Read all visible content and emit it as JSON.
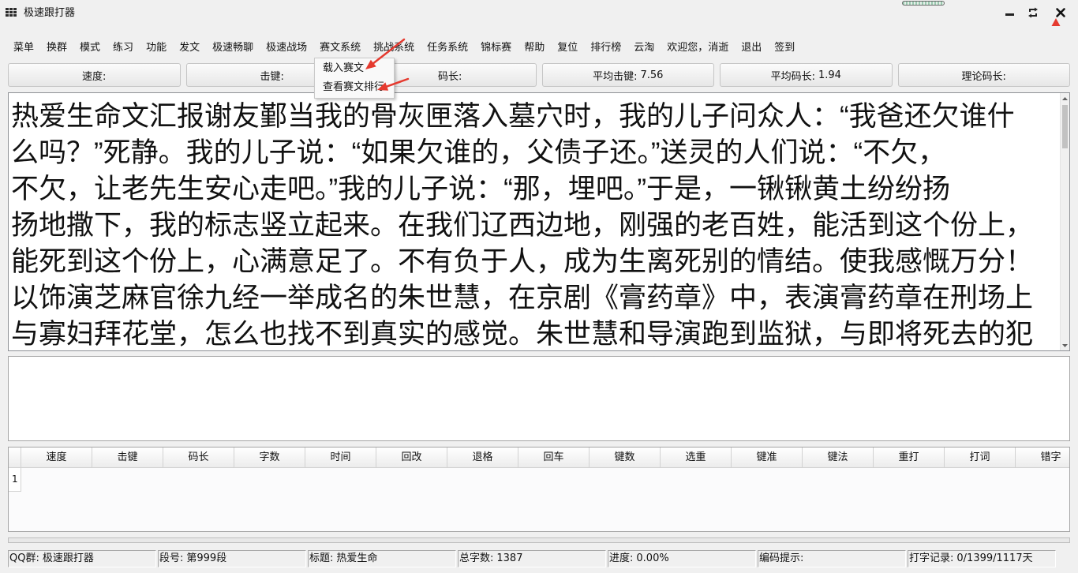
{
  "window": {
    "title": "极速跟打器",
    "icons": {
      "app": "grid-icon",
      "minimize": "minimize-icon",
      "restore": "restore-icon",
      "close": "close-icon"
    }
  },
  "menu": {
    "items": [
      "菜单",
      "换群",
      "模式",
      "练习",
      "功能",
      "发文",
      "极速畅聊",
      "极速战场",
      "赛文系统",
      "挑战系统",
      "任务系统",
      "锦标赛",
      "帮助",
      "复位",
      "排行榜",
      "云淘",
      "欢迎您，消逝",
      "退出",
      "签到"
    ]
  },
  "dropdown": {
    "items": [
      "载入赛文",
      "查看赛文排行"
    ]
  },
  "stats": [
    {
      "label": "速度:",
      "value": ""
    },
    {
      "label": "击键:",
      "value": ""
    },
    {
      "label": "码长:",
      "value": ""
    },
    {
      "label": "平均击键:",
      "value": "7.56"
    },
    {
      "label": "平均码长:",
      "value": "1.94"
    },
    {
      "label": "理论码长:",
      "value": ""
    }
  ],
  "article": {
    "lines": [
      "热爱生命文汇报谢友鄞当我的骨灰匣落入墓穴时，我的儿子问众人：“我爸还欠谁什",
      "么吗？”死静。我的儿子说：“如果欠谁的，父债子还。”送灵的人们说：“不欠，",
      "不欠，让老先生安心走吧。”我的儿子说：“那，埋吧。”于是，一锹锹黄土纷纷扬",
      "扬地撒下，我的标志竖立起来。在我们辽西边地，刚强的老百姓，能活到这个份上，",
      "能死到这个份上，心满意足了。不有负于人，成为生离死别的情结。使我感慨万分！",
      "以饰演芝麻官徐九经一举成名的朱世慧，在京剧《膏药章》中，表演膏药章在刑场上",
      "与寡妇拜花堂，怎么也找不到真实的感觉。朱世慧和导演跑到监狱，与即将死去的犯"
    ]
  },
  "input": {
    "value": ""
  },
  "results_table": {
    "columns": [
      "速度",
      "击键",
      "码长",
      "字数",
      "时间",
      "回改",
      "退格",
      "回车",
      "键数",
      "选重",
      "键准",
      "键法",
      "重打",
      "打词",
      "错字"
    ],
    "rows": [
      {
        "index": "1"
      }
    ]
  },
  "progress_bar": {
    "fraction": 0
  },
  "status_bar": [
    {
      "label": "QQ群:",
      "value": "极速跟打器"
    },
    {
      "label": "段号:",
      "value": "第999段"
    },
    {
      "label": "标题:",
      "value": "热爱生命"
    },
    {
      "label": "总字数:",
      "value": "1387"
    },
    {
      "label": "进度:",
      "value": "0.00%"
    },
    {
      "label": "编码提示:",
      "value": ""
    },
    {
      "label": "打字记录:",
      "value": "0/1399/1117天"
    }
  ],
  "colors": {
    "window_bg": "#f0f0f0",
    "annotation": "#e53a2f",
    "text": "#111111"
  }
}
